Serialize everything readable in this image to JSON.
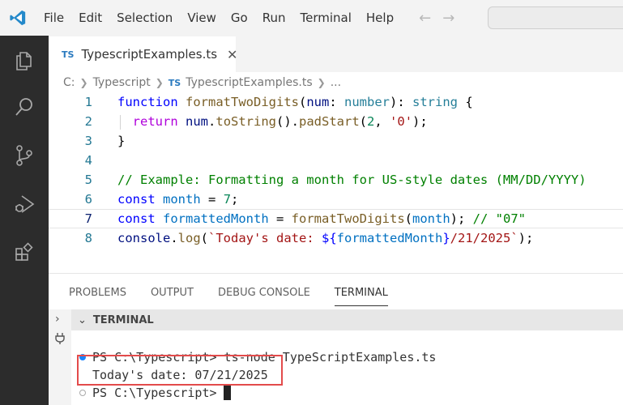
{
  "menu": {
    "items": [
      "File",
      "Edit",
      "Selection",
      "View",
      "Go",
      "Run",
      "Terminal",
      "Help"
    ],
    "back_icon": "arrow-left-icon",
    "forward_icon": "arrow-right-icon"
  },
  "activity_bar": {
    "icons": [
      "explorer-icon",
      "search-icon",
      "source-control-icon",
      "run-debug-icon",
      "extensions-icon"
    ]
  },
  "tab": {
    "badge": "TS",
    "label": "TypescriptExamples.ts",
    "close": "✕"
  },
  "breadcrumb": {
    "drive": "C:",
    "folder": "Typescript",
    "badge": "TS",
    "file": "TypescriptExamples.ts",
    "more": "..."
  },
  "editor": {
    "line_numbers": [
      "1",
      "2",
      "3",
      "4",
      "5",
      "6",
      "7",
      "8"
    ],
    "current_line": 7
  },
  "panel": {
    "tabs": [
      "PROBLEMS",
      "OUTPUT",
      "DEBUG CONSOLE",
      "TERMINAL"
    ],
    "active_tab": "TERMINAL",
    "header": "TERMINAL",
    "terminal_lines": [
      "PS C:\\Typescript> ts-node TypeScriptExamples.ts",
      "Today's date: 07/21/2025",
      "PS C:\\Typescript>"
    ]
  },
  "colors": {
    "accent": "#007acc",
    "highlight_box": "#e34b4b",
    "activity_bar": "#2c2c2c"
  }
}
